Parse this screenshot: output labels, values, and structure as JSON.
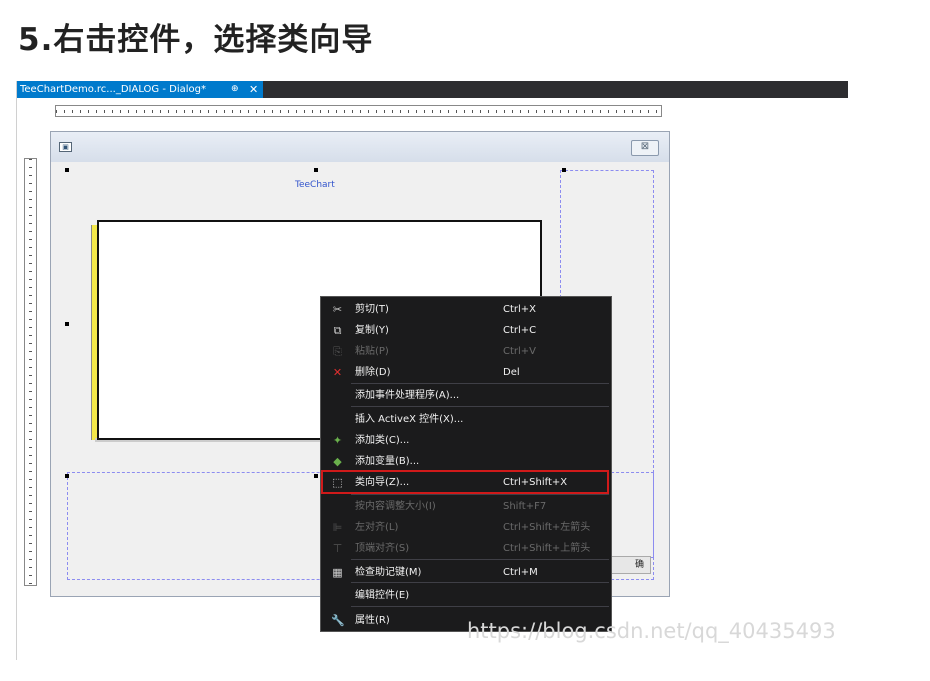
{
  "heading": "5.右击控件，选择类向导",
  "tab": {
    "title": "TeeChartDemo.rc..._DIALOG - Dialog*",
    "pin_glyph": "⊕",
    "close_glyph": "✕"
  },
  "dialog": {
    "close_glyph": "⊠"
  },
  "chart": {
    "title": "TeeChart"
  },
  "partial_button": "确",
  "menu": {
    "items": [
      {
        "name": "cut",
        "icon": "scissors-icon",
        "glyph": "✂",
        "label": "剪切(T)",
        "shortcut": "Ctrl+X",
        "enabled": true
      },
      {
        "name": "copy",
        "icon": "copy-icon",
        "glyph": "⧉",
        "label": "复制(Y)",
        "shortcut": "Ctrl+C",
        "enabled": true
      },
      {
        "name": "paste",
        "icon": "paste-icon",
        "glyph": "⎘",
        "label": "粘贴(P)",
        "shortcut": "Ctrl+V",
        "enabled": false
      },
      {
        "name": "delete",
        "icon": "delete-icon",
        "glyph": "✕",
        "label": "删除(D)",
        "shortcut": "Del",
        "enabled": true
      },
      {
        "name": "add-event-handler",
        "icon": "",
        "glyph": "",
        "label": "添加事件处理程序(A)...",
        "shortcut": "",
        "enabled": true
      },
      {
        "name": "insert-activex",
        "icon": "",
        "glyph": "",
        "label": "插入 ActiveX 控件(X)...",
        "shortcut": "",
        "enabled": true
      },
      {
        "name": "add-class",
        "icon": "add-class-icon",
        "glyph": "✦",
        "label": "添加类(C)...",
        "shortcut": "",
        "enabled": true
      },
      {
        "name": "add-variable",
        "icon": "add-variable-icon",
        "glyph": "◆",
        "label": "添加变量(B)...",
        "shortcut": "",
        "enabled": true
      },
      {
        "name": "class-wizard",
        "icon": "class-wizard-icon",
        "glyph": "⬚",
        "label": "类向导(Z)...",
        "shortcut": "Ctrl+Shift+X",
        "enabled": true
      },
      {
        "name": "size-to-content",
        "icon": "",
        "glyph": "",
        "label": "按内容调整大小(I)",
        "shortcut": "Shift+F7",
        "enabled": false
      },
      {
        "name": "align-left",
        "icon": "align-left-icon",
        "glyph": "⊫",
        "label": "左对齐(L)",
        "shortcut": "Ctrl+Shift+左箭头",
        "enabled": false
      },
      {
        "name": "align-top",
        "icon": "align-top-icon",
        "glyph": "⊤",
        "label": "顶端对齐(S)",
        "shortcut": "Ctrl+Shift+上箭头",
        "enabled": false
      },
      {
        "name": "check-mnemonics",
        "icon": "mnemonics-icon",
        "glyph": "▦",
        "label": "检查助记键(M)",
        "shortcut": "Ctrl+M",
        "enabled": true
      },
      {
        "name": "edit-control",
        "icon": "",
        "glyph": "",
        "label": "编辑控件(E)",
        "shortcut": "",
        "enabled": true
      },
      {
        "name": "properties",
        "icon": "wrench-icon",
        "glyph": "🔧",
        "label": "属性(R)",
        "shortcut": "",
        "enabled": true
      }
    ]
  },
  "watermark": "https://blog.csdn.net/qq_40435493"
}
